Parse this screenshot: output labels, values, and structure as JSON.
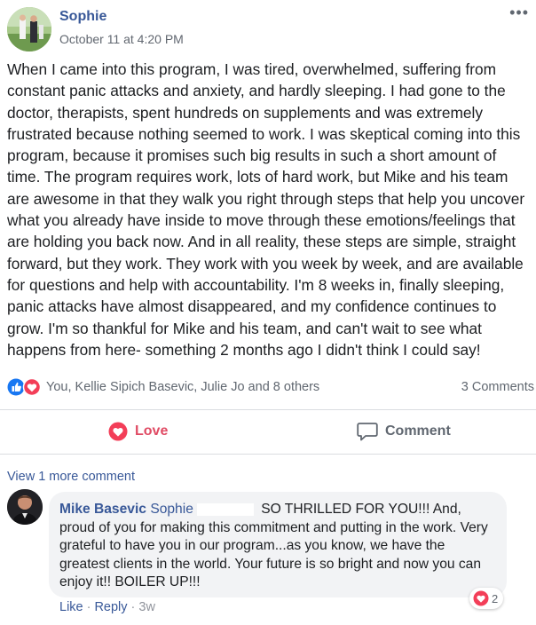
{
  "post": {
    "author": "Sophie",
    "timestamp": "October 11 at 4:20 PM",
    "more_menu": "•••",
    "text": "When I came into this program, I was tired, overwhelmed, suffering from constant panic attacks and anxiety, and hardly sleeping. I had gone to the doctor, therapists, spent hundreds on supplements and was extremely frustrated because nothing seemed to work. I was skeptical coming into this program, because it promises such big results in such a short amount of time. The program requires work, lots of hard work, but Mike and his team are awesome in that they walk you right through steps that help you uncover what you already have inside to move through these emotions/feelings that are holding you back now. And in all reality, these steps are simple, straight forward, but they work. They work with you week by week, and are available for questions and help with accountability. I'm 8 weeks in, finally sleeping, panic attacks have almost disappeared, and my confidence continues to grow. I'm so thankful for Mike and his team, and can't wait to see what happens from here- something 2 months ago I didn't think I could say!"
  },
  "reactions": {
    "icons": [
      "like-icon",
      "love-icon"
    ],
    "names": "You, Kellie Sipich Basevic, Julie Jo and 8 others",
    "comments_count": "3 Comments"
  },
  "actions": {
    "love_label": "Love",
    "comment_label": "Comment"
  },
  "comments": {
    "view_more": "View 1 more comment",
    "items": [
      {
        "author": "Mike Basevic",
        "mention": "Sophie",
        "text": "SO THRILLED FOR YOU!!! And, proud of you for making this commitment and putting in the work. Very grateful to have you in our program...as you know, we have the greatest clients in the world. Your future is so bright and now you can enjoy it!! BOILER UP!!!",
        "reaction_count": "2",
        "like_label": "Like",
        "reply_label": "Reply",
        "time": "3w"
      }
    ]
  },
  "colors": {
    "link": "#385898",
    "love": "#e04b64",
    "like": "#1877f2",
    "muted": "#606770"
  }
}
